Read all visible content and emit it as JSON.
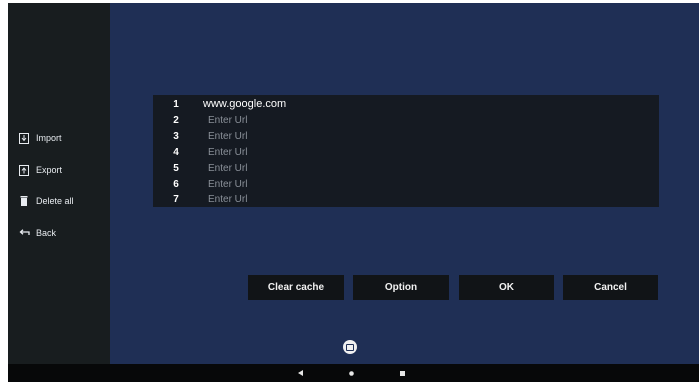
{
  "sidebar": {
    "items": [
      {
        "label": "Import",
        "icon": "import-icon"
      },
      {
        "label": "Export",
        "icon": "export-icon"
      },
      {
        "label": "Delete all",
        "icon": "trash-icon"
      },
      {
        "label": "Back",
        "icon": "back-arrow-icon"
      }
    ]
  },
  "url_list": {
    "rows": [
      {
        "number": "1",
        "value": "www.google.com",
        "placeholder": "Enter Url"
      },
      {
        "number": "2",
        "value": "",
        "placeholder": "Enter Url"
      },
      {
        "number": "3",
        "value": "",
        "placeholder": "Enter Url"
      },
      {
        "number": "4",
        "value": "",
        "placeholder": "Enter Url"
      },
      {
        "number": "5",
        "value": "",
        "placeholder": "Enter Url"
      },
      {
        "number": "6",
        "value": "",
        "placeholder": "Enter Url"
      },
      {
        "number": "7",
        "value": "",
        "placeholder": "Enter Url"
      }
    ]
  },
  "buttons": {
    "clear_cache": "Clear cache",
    "option": "Option",
    "ok": "OK",
    "cancel": "Cancel"
  },
  "navbar": {
    "icons": [
      "back-triangle-icon",
      "home-circle-icon",
      "recents-square-icon"
    ]
  },
  "colors": {
    "background": "#1f2f55",
    "sidebar": "#181d1f",
    "panel": "#151a22",
    "button": "#111417"
  }
}
